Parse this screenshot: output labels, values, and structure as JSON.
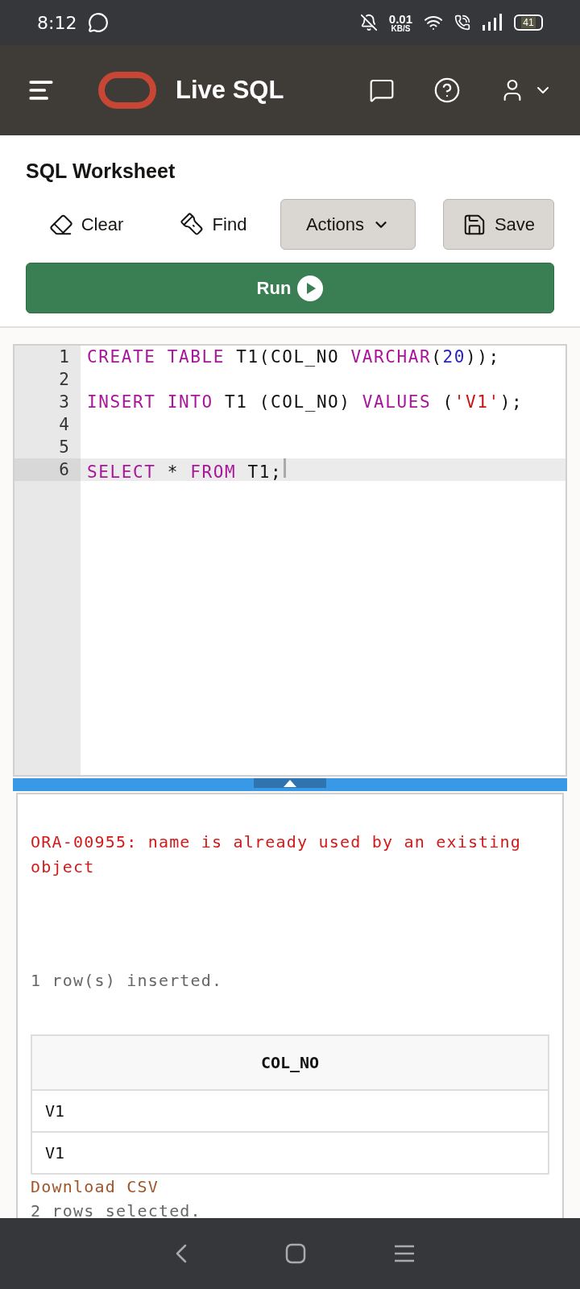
{
  "status_bar": {
    "time": "8:12",
    "net_speed": "0.01",
    "net_unit": "KB/S",
    "battery": "41"
  },
  "header": {
    "title": "Live SQL"
  },
  "worksheet": {
    "title": "SQL Worksheet",
    "toolbar": [
      {
        "label": "Clear",
        "kind": "clear"
      },
      {
        "label": "Find",
        "kind": "find"
      },
      {
        "label": "Actions",
        "kind": "dropdown"
      },
      {
        "label": "Save",
        "kind": "save"
      }
    ],
    "run_button": "Run"
  },
  "editor": {
    "lines": [
      {
        "number": "1",
        "current": false,
        "tokens": [
          {
            "text": "CREATE TABLE",
            "kind": "keyword"
          },
          {
            "text": " T1(COL_NO ",
            "kind": "plain"
          },
          {
            "text": "VARCHAR",
            "kind": "keyword"
          },
          {
            "text": "(",
            "kind": "plain"
          },
          {
            "text": "20",
            "kind": "number"
          },
          {
            "text": "));",
            "kind": "plain"
          }
        ]
      },
      {
        "number": "2",
        "current": false
      },
      {
        "number": "3",
        "current": false,
        "tokens": [
          {
            "text": "INSERT INTO",
            "kind": "keyword"
          },
          {
            "text": " T1 (COL_NO) ",
            "kind": "plain"
          },
          {
            "text": "VALUES",
            "kind": "keyword"
          },
          {
            "text": " (",
            "kind": "plain"
          },
          {
            "text": "'V1'",
            "kind": "string"
          },
          {
            "text": ");",
            "kind": "plain"
          }
        ]
      },
      {
        "number": "4",
        "current": false
      },
      {
        "number": "5",
        "current": false
      },
      {
        "number": "6",
        "current": true,
        "tokens": [
          {
            "text": "SELECT",
            "kind": "keyword"
          },
          {
            "text": " * ",
            "kind": "plain"
          },
          {
            "text": "FROM",
            "kind": "keyword"
          },
          {
            "text": " T1;",
            "kind": "plain"
          }
        ]
      }
    ]
  },
  "results": {
    "error": "ORA-00955: name is already used by an existing object",
    "inserted_message": "1 row(s) inserted.",
    "table": {
      "columns": [
        "COL_NO"
      ],
      "rows": [
        [
          "V1"
        ],
        [
          "V1"
        ]
      ]
    },
    "download_link": "Download CSV",
    "selected_message": "2 rows selected."
  }
}
